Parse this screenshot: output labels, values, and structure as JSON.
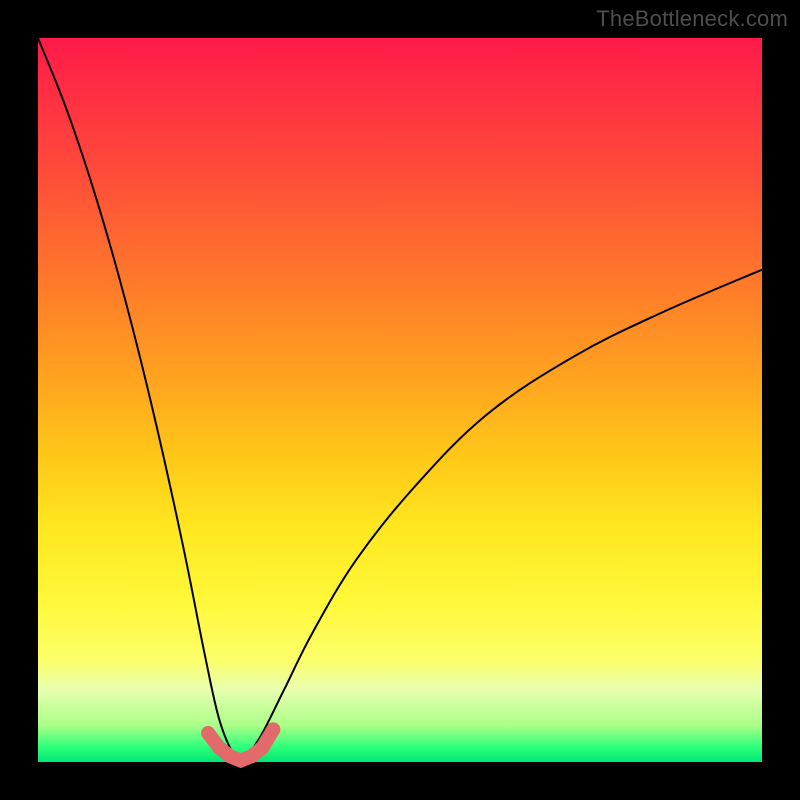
{
  "watermark": "TheBottleneck.com",
  "colors": {
    "frame_bg": "#000000",
    "watermark_text": "#4e4e4e",
    "curve_stroke": "#000000",
    "marker_fill": "#e26a6a",
    "gradient_top": "#ff1a4a",
    "gradient_bottom": "#00e676"
  },
  "chart_data": {
    "type": "line",
    "title": "",
    "xlabel": "",
    "ylabel": "",
    "xlim": [
      0,
      100
    ],
    "ylim": [
      0,
      100
    ],
    "grid": false,
    "legend": false,
    "annotations": [],
    "description": "Single V-shaped bottleneck curve over a vertical red-to-green gradient. Minimum (zero bottleneck) near x ≈ 28. Left branch rises steeply toward 100 as x → 0; right branch rises more gradually toward ~68 as x → 100. Pink markers cluster along the trough near the minimum.",
    "series": [
      {
        "name": "bottleneck-curve",
        "x": [
          0,
          4,
          8,
          12,
          16,
          20,
          23,
          25,
          27,
          28,
          29,
          31,
          34,
          38,
          44,
          52,
          62,
          74,
          86,
          100
        ],
        "values": [
          100,
          90,
          78,
          64,
          48,
          30,
          15,
          6,
          1,
          0,
          1,
          4,
          10,
          18,
          28,
          38,
          48,
          56,
          62,
          68
        ]
      }
    ],
    "markers": {
      "name": "trough-dots",
      "x": [
        23.5,
        25.0,
        26.5,
        28.0,
        29.5,
        31.0,
        32.5
      ],
      "values": [
        4.0,
        2.0,
        0.8,
        0.2,
        0.8,
        2.0,
        4.5
      ]
    }
  }
}
